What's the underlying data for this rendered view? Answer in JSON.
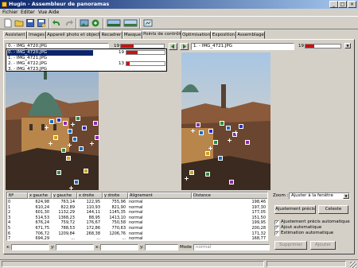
{
  "window": {
    "title": "Hugin - Assembleur de panoramas",
    "controls": [
      "_",
      "□",
      "×"
    ]
  },
  "menu": [
    "Fichier",
    "Editer",
    "Vue",
    "Aide"
  ],
  "toolbar": {
    "icons": [
      "new-project-icon",
      "open-icon",
      "save-icon",
      "save-as-icon",
      "undo-icon",
      "redo-icon",
      "add-images-icon",
      "optimize-icon",
      "preview-icon",
      "fast-preview-icon",
      "panorama-icon"
    ]
  },
  "tabs": [
    "Assistant",
    "Images",
    "Appareil photo et objectif",
    "Recadrer",
    "Masque",
    "Points de contrôle",
    "Optimisation",
    "Exposition",
    "Assemblage"
  ],
  "active_tab": "Points de contrôle",
  "left": {
    "selected_image": "0. - IMG_4720.JPG",
    "count": "19",
    "count_fraction": 0.3,
    "dropdown_items": [
      {
        "label": "0. - IMG_4720.JPG",
        "count": "19",
        "fraction": 0.3,
        "selected": true
      },
      {
        "label": "1. - IMG_4721.JPG",
        "count": "",
        "fraction": null,
        "selected": false
      },
      {
        "label": "2. - IMG_4722.JPG",
        "count": "13",
        "fraction": 0.08,
        "selected": false
      },
      {
        "label": "3. - IMG_4723.JPG",
        "count": "",
        "fraction": null,
        "selected": false
      }
    ]
  },
  "right": {
    "selected_image": "1. - IMG_4721.JPG",
    "count": "19",
    "count_fraction": 0.25
  },
  "table": {
    "headers": [
      "Nº",
      "x gauche",
      "y gauche",
      "x droite",
      "y droite",
      "Alignement",
      "Distance"
    ],
    "rows": [
      [
        "0",
        "624,98",
        "763,14",
        "122,95",
        "755,96",
        "normal",
        "198,46"
      ],
      [
        "1",
        "610,24",
        "822,89",
        "110,93",
        "821,90",
        "normal",
        "197,30"
      ],
      [
        "2",
        "601,30",
        "1132,29",
        "144,11",
        "1145,35",
        "normal",
        "177,05"
      ],
      [
        "3",
        "514,53",
        "1368,23",
        "88,95",
        "1413,10",
        "normal",
        "151,50"
      ],
      [
        "4",
        "676,24",
        "759,72",
        "176,67",
        "750,58",
        "normal",
        "199,95"
      ],
      [
        "5",
        "671,75",
        "788,53",
        "172,86",
        "770,63",
        "normal",
        "200,28"
      ],
      [
        "6",
        "706,72",
        "1209,84",
        "268,38",
        "1206,76",
        "normal",
        "171,32"
      ],
      [
        "7",
        "694,29",
        "...",
        "...",
        "...",
        "normal",
        "168,77"
      ]
    ]
  },
  "side": {
    "zoom_label": "Zoom :",
    "zoom_value": "Ajuster à la fenêtre",
    "fine_tune_button": "Ajustement précis",
    "celeste_button": "Celeste",
    "checkboxes": [
      {
        "label": "Ajustement précis automatique",
        "checked": true
      },
      {
        "label": "Ajout automatique",
        "checked": true
      },
      {
        "label": "Estimation automatique",
        "checked": true
      }
    ],
    "delete_button": "Supprimer",
    "add_button": "Ajouter"
  },
  "edit": {
    "x1_label": "x:",
    "y1_label": "y:",
    "x2_label": "x:",
    "y2_label": "y:",
    "mode_label": "Mode :",
    "mode_value": "normal"
  }
}
